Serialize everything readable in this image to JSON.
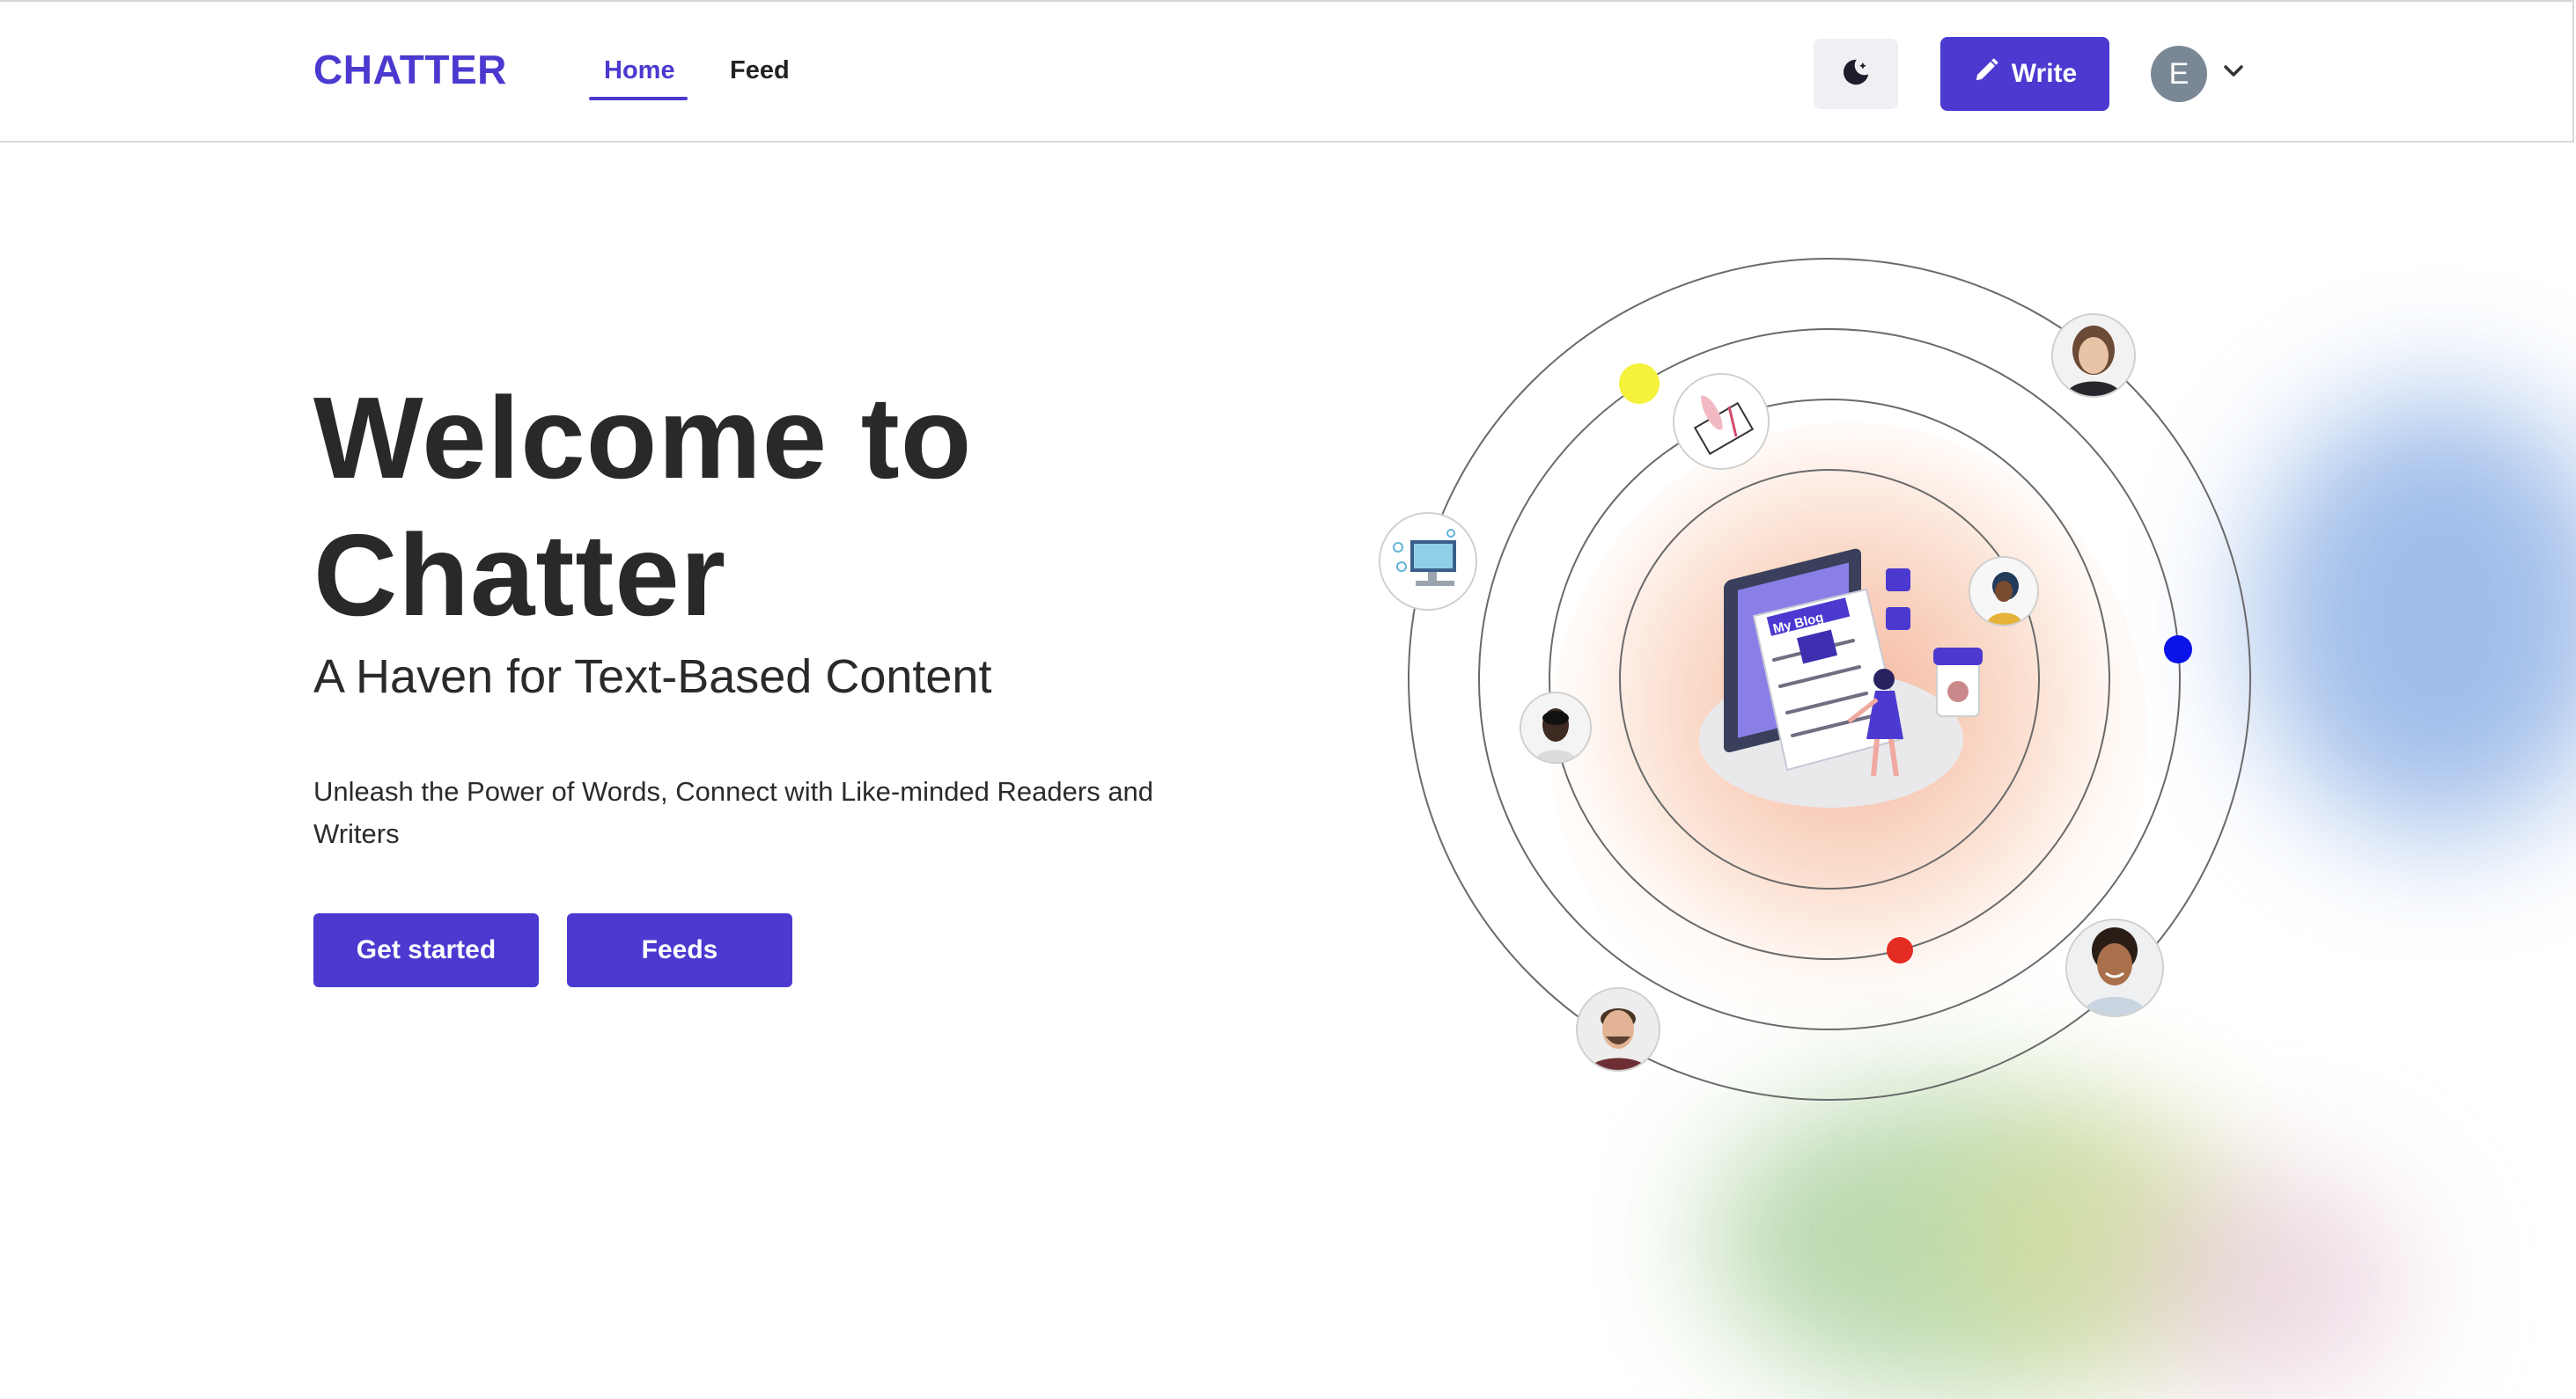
{
  "header": {
    "brand": "CHATTER",
    "nav": [
      {
        "label": "Home",
        "active": true
      },
      {
        "label": "Feed",
        "active": false
      }
    ],
    "theme_icon": "moon-icon",
    "write_button": {
      "label": "Write",
      "icon": "pencil-icon"
    },
    "user": {
      "initial": "E",
      "menu_icon": "chevron-down-icon"
    }
  },
  "hero": {
    "title_line1": "Welcome to",
    "title_line2": "Chatter",
    "subtitle": "A Haven for Text-Based Content",
    "description": "Unleash the Power of Words, Connect with Like-minded Readers and Writers",
    "buttons": [
      {
        "label": "Get started"
      },
      {
        "label": "Feeds"
      }
    ]
  },
  "illustration": {
    "center": "blog-writing-illustration",
    "center_text": "My Blog",
    "orbit_dots": [
      {
        "color": "#f5f23c"
      },
      {
        "color": "#0a13e8"
      },
      {
        "color": "#e42b24"
      }
    ]
  },
  "colors": {
    "accent": "#4b39d0",
    "text": "#262626",
    "theme_button_bg": "#eef0f4",
    "avatar_bg": "#7a8896"
  }
}
